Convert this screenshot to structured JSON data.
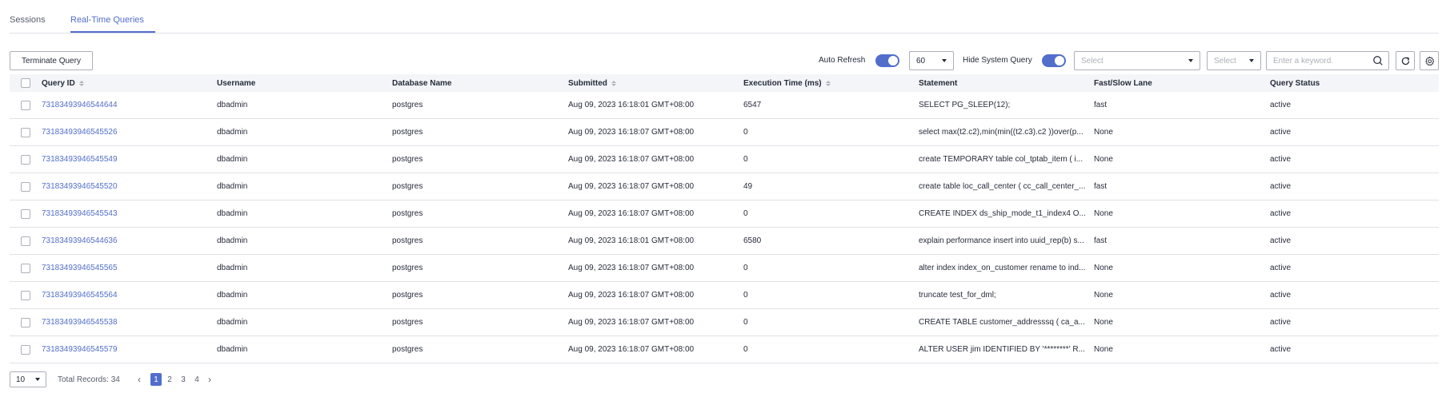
{
  "tabs": [
    {
      "label": "Sessions",
      "active": false
    },
    {
      "label": "Real-Time Queries",
      "active": true
    }
  ],
  "toolbar": {
    "terminate_label": "Terminate Query",
    "auto_refresh_label": "Auto Refresh",
    "auto_refresh_on": true,
    "refresh_interval": "60",
    "hide_system_label": "Hide System Query",
    "hide_system_on": true,
    "select1_placeholder": "Select",
    "select2_placeholder": "Select",
    "search_placeholder": "Enter a keyword."
  },
  "icons": {
    "search": "search-icon",
    "refresh": "refresh-icon",
    "settings": "gear-icon",
    "caret": "chevron-down-icon"
  },
  "colors": {
    "accent": "#526ecc",
    "border": "#dfe1e6",
    "header_bg": "#f3f5f8"
  },
  "table": {
    "columns": [
      "Query ID",
      "Username",
      "Database Name",
      "Submitted",
      "Execution Time (ms)",
      "Statement",
      "Fast/Slow Lane",
      "Query Status"
    ],
    "rows": [
      {
        "id": "73183493946544644",
        "user": "dbadmin",
        "db": "postgres",
        "submitted": "Aug 09, 2023 16:18:01 GMT+08:00",
        "exec": "6547",
        "statement": "SELECT PG_SLEEP(12);",
        "lane": "fast",
        "status": "active"
      },
      {
        "id": "73183493946545526",
        "user": "dbadmin",
        "db": "postgres",
        "submitted": "Aug 09, 2023 16:18:07 GMT+08:00",
        "exec": "0",
        "statement": "select max(t2.c2),min(min((t2.c3).c2 ))over(p...",
        "lane": "None",
        "status": "active"
      },
      {
        "id": "73183493946545549",
        "user": "dbadmin",
        "db": "postgres",
        "submitted": "Aug 09, 2023 16:18:07 GMT+08:00",
        "exec": "0",
        "statement": "create TEMPORARY table col_tptab_item ( i...",
        "lane": "None",
        "status": "active"
      },
      {
        "id": "73183493946545520",
        "user": "dbadmin",
        "db": "postgres",
        "submitted": "Aug 09, 2023 16:18:07 GMT+08:00",
        "exec": "49",
        "statement": "create table loc_call_center ( cc_call_center_...",
        "lane": "fast",
        "status": "active"
      },
      {
        "id": "73183493946545543",
        "user": "dbadmin",
        "db": "postgres",
        "submitted": "Aug 09, 2023 16:18:07 GMT+08:00",
        "exec": "0",
        "statement": "CREATE INDEX ds_ship_mode_t1_index4 O...",
        "lane": "None",
        "status": "active"
      },
      {
        "id": "73183493946544636",
        "user": "dbadmin",
        "db": "postgres",
        "submitted": "Aug 09, 2023 16:18:01 GMT+08:00",
        "exec": "6580",
        "statement": "explain performance insert into uuid_rep(b) s...",
        "lane": "fast",
        "status": "active"
      },
      {
        "id": "73183493946545565",
        "user": "dbadmin",
        "db": "postgres",
        "submitted": "Aug 09, 2023 16:18:07 GMT+08:00",
        "exec": "0",
        "statement": "alter index index_on_customer rename to ind...",
        "lane": "None",
        "status": "active"
      },
      {
        "id": "73183493946545564",
        "user": "dbadmin",
        "db": "postgres",
        "submitted": "Aug 09, 2023 16:18:07 GMT+08:00",
        "exec": "0",
        "statement": "truncate test_for_dml;",
        "lane": "None",
        "status": "active"
      },
      {
        "id": "73183493946545538",
        "user": "dbadmin",
        "db": "postgres",
        "submitted": "Aug 09, 2023 16:18:07 GMT+08:00",
        "exec": "0",
        "statement": "CREATE TABLE customer_addresssq ( ca_a...",
        "lane": "None",
        "status": "active"
      },
      {
        "id": "73183493946545579",
        "user": "dbadmin",
        "db": "postgres",
        "submitted": "Aug 09, 2023 16:18:07 GMT+08:00",
        "exec": "0",
        "statement": "ALTER USER jim IDENTIFIED BY '********' R...",
        "lane": "None",
        "status": "active"
      }
    ]
  },
  "pagination": {
    "page_size": "10",
    "total_label": "Total Records: 34",
    "pages": [
      "1",
      "2",
      "3",
      "4"
    ],
    "current": "1"
  }
}
